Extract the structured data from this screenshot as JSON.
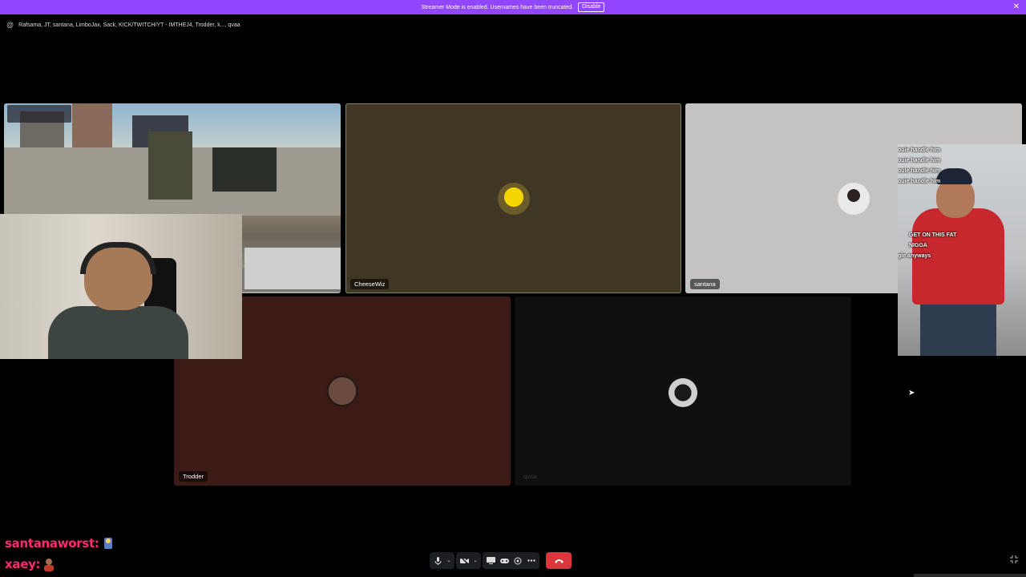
{
  "banner": {
    "text": "Streamer Mode is enabled. Usernames have been truncated.",
    "disable_label": "Disable",
    "close": "✕"
  },
  "header": {
    "channel_users": "Rafsama, JT, santana, LimboJax, Sack, KICK/TWITCH/YT - IMTHEJ4, Trodder, k..., qvaa"
  },
  "tiles": {
    "cheesewiz": {
      "name": "CheeseWiz",
      "speaking": true
    },
    "santana": {
      "name": "santana"
    },
    "trodder": {
      "name": "Trodder"
    },
    "qvaa": {
      "name": "qvaa"
    }
  },
  "side_video": {
    "captions_top": [
      "ouie handle him",
      "ouie handle him",
      "ouie handle him",
      "ouie handle him"
    ],
    "captions_mid": [
      "GET ON THIS FAT",
      "NIGGA",
      "gie anyways"
    ]
  },
  "chat": [
    {
      "user": "santanaworst:"
    },
    {
      "user": "xaey:"
    }
  ],
  "controls": {
    "mic_icon": "microphone-icon",
    "camera_icon": "camera-off-icon",
    "screen_share_icon": "screen-share-icon",
    "activity_icon": "gamepad-icon",
    "soundboard_icon": "soundboard-icon",
    "more_icon": "more-icon",
    "end_call_icon": "hangup-icon"
  },
  "colors": {
    "banner": "#9147ff",
    "speaking_outline": "#3ba55d",
    "end_call": "#da373c",
    "chat_username": "#ff2b6e"
  }
}
